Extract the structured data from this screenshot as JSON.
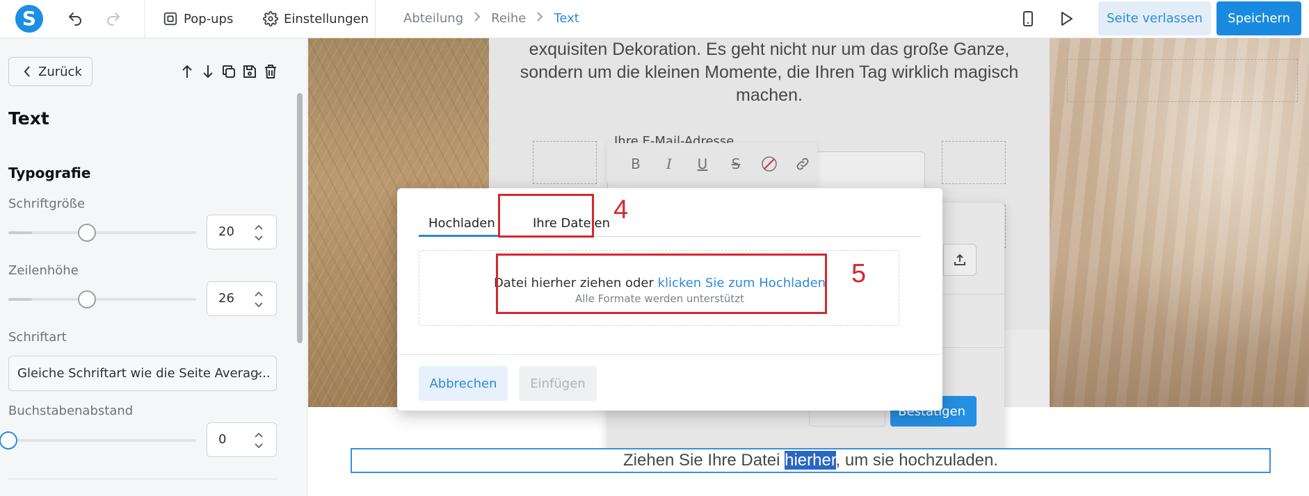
{
  "topbar": {
    "logo_letter": "S",
    "popups_label": "Pop-ups",
    "settings_label": "Einstellungen",
    "breadcrumb": [
      "Abteilung",
      "Reihe",
      "Text"
    ],
    "leave_label": "Seite verlassen",
    "save_label": "Speichern"
  },
  "sidebar": {
    "back_label": "Zurück",
    "title": "Text",
    "section": "Typografie",
    "font_size": {
      "label": "Schriftgröße",
      "value": "20",
      "slider_fraction": 0.42
    },
    "line_height": {
      "label": "Zeilenhöhe",
      "value": "26",
      "slider_fraction": 0.42
    },
    "font_family": {
      "label": "Schriftart",
      "value": "Gleiche Schriftart wie die Seite Averag..."
    },
    "letter_spacing": {
      "label": "Buchstabenabstand",
      "value": "0",
      "slider_fraction": 0.0
    }
  },
  "canvas": {
    "intro_lines": [
      "exquisiten Dekoration. Es geht nicht nur um das große Ganze,",
      "sondern um die kleinen Momente, die Ihren Tag wirklich magisch",
      "machen."
    ],
    "email_label": "Ihre E-Mail-Adresse",
    "confirm_label": "Bestätigen",
    "drop_text_before": "Ziehen Sie Ihre Datei ",
    "drop_text_highlight": "hierher",
    "drop_text_after": ", um sie hochzuladen."
  },
  "modal": {
    "tabs": [
      "Hochladen",
      "Ihre Dateien"
    ],
    "active_tab": "Hochladen",
    "drop_main": "Datei hierher ziehen oder ",
    "drop_link": "klicken Sie zum Hochladen",
    "drop_sub": "Alle Formate werden unterstützt",
    "cancel_label": "Abbrechen",
    "insert_label": "Einfügen"
  },
  "annotations": [
    "4",
    "5"
  ],
  "colors": {
    "accent": "#2b8ae0",
    "annotation": "#d4282e"
  }
}
